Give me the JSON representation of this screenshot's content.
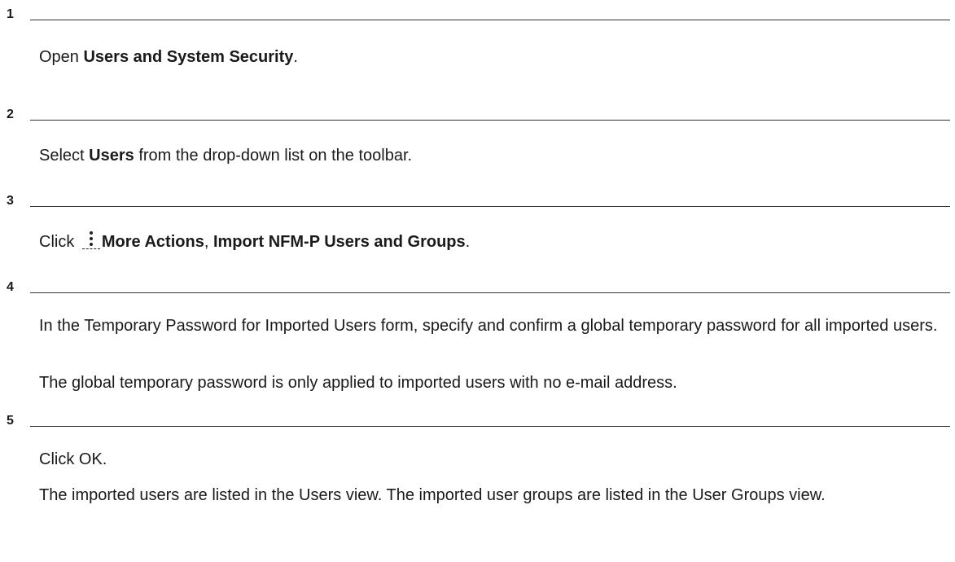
{
  "steps": [
    {
      "number": "1",
      "paragraphs": [
        {
          "pre": "Open ",
          "bold": "Users and System Security",
          "post": "."
        }
      ]
    },
    {
      "number": "2",
      "paragraphs": [
        {
          "pre": "Select ",
          "bold": "Users",
          "post": " from the drop-down list on the toolbar."
        }
      ]
    },
    {
      "number": "3",
      "paragraphs": [
        {
          "pre": "Click ",
          "icon": "more-actions-kebab-icon",
          "bold1": "More Actions",
          "mid": ", ",
          "bold2": "Import NFM-P Users and Groups",
          "post": "."
        }
      ]
    },
    {
      "number": "4",
      "paragraphs": [
        {
          "text": "In the Temporary Password for Imported Users form, specify and confirm a global temporary password for all imported users."
        },
        {
          "text": "The global temporary password is only applied to imported users with no e-mail address."
        }
      ]
    },
    {
      "number": "5",
      "paragraphs": [
        {
          "text": "Click OK."
        },
        {
          "text": "The imported users are listed in the Users view. The imported user groups are listed in the User Groups view."
        }
      ]
    }
  ]
}
